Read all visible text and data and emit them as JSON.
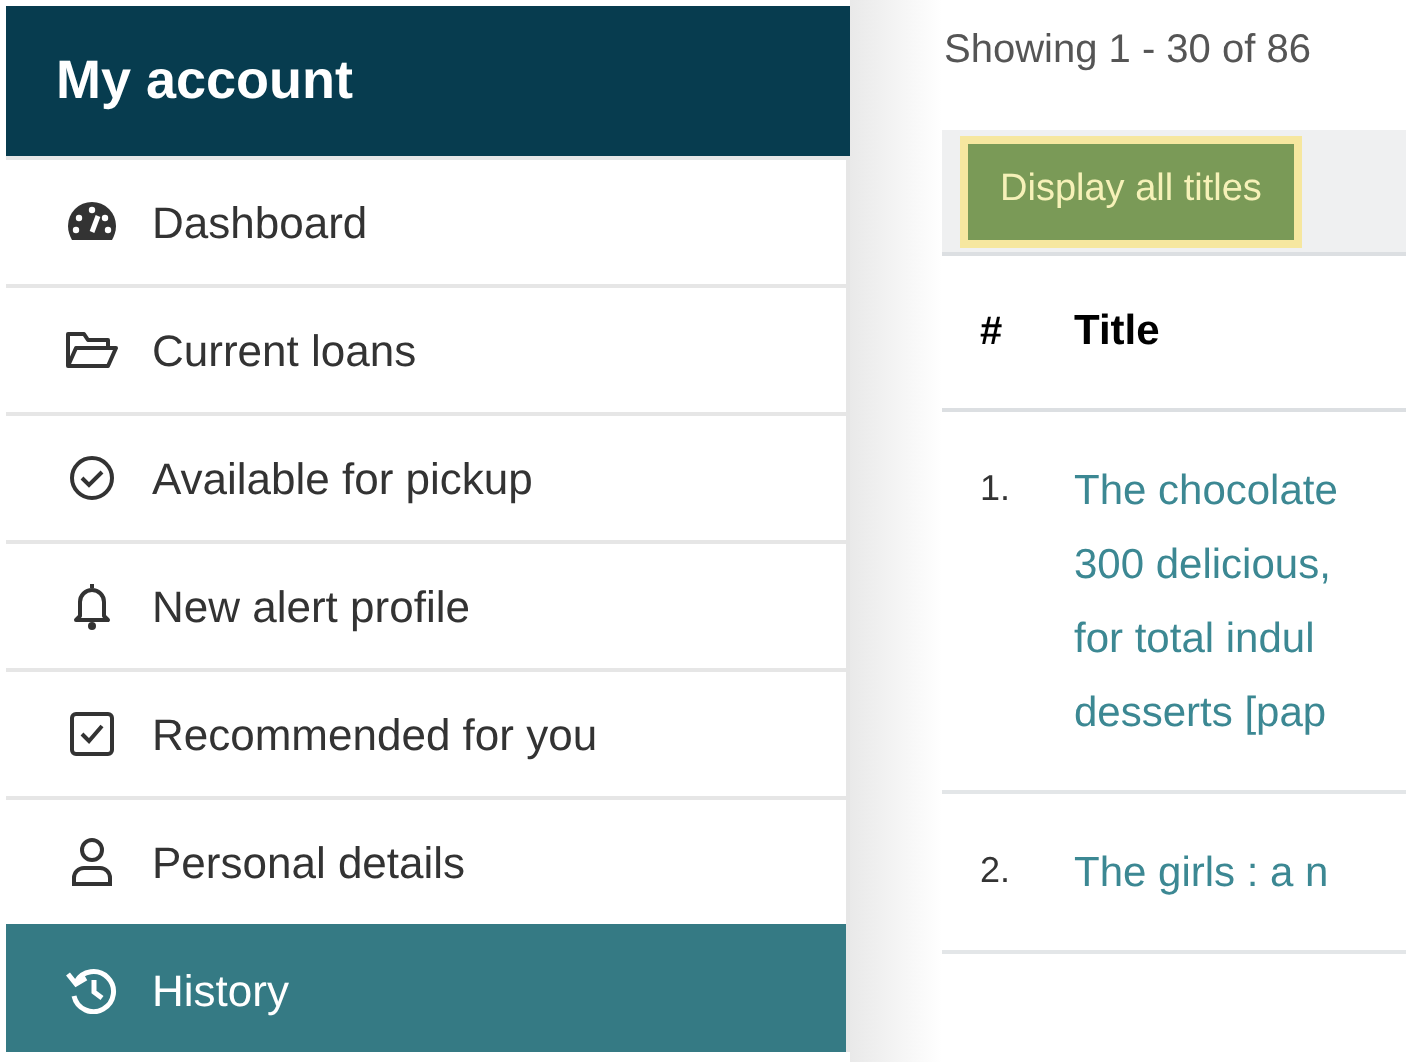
{
  "sidebar": {
    "title": "My account",
    "items": [
      {
        "label": "Dashboard",
        "selected": false
      },
      {
        "label": "Current loans",
        "selected": false
      },
      {
        "label": "Available for pickup",
        "selected": false
      },
      {
        "label": "New alert profile",
        "selected": false
      },
      {
        "label": "Recommended for you",
        "selected": false
      },
      {
        "label": "Personal details",
        "selected": false
      },
      {
        "label": "History",
        "selected": true
      }
    ]
  },
  "summary": "Showing 1 - 30 of 86",
  "toolbar": {
    "button": "Display all titles"
  },
  "table": {
    "columns": [
      "#",
      "Title"
    ],
    "rows": [
      {
        "number": "1.",
        "title_lines": [
          "The chocolate",
          "300 delicious,",
          "for total indul",
          "desserts [pap"
        ]
      },
      {
        "number": "2.",
        "title_lines": [
          "The girls : a n"
        ]
      }
    ]
  }
}
